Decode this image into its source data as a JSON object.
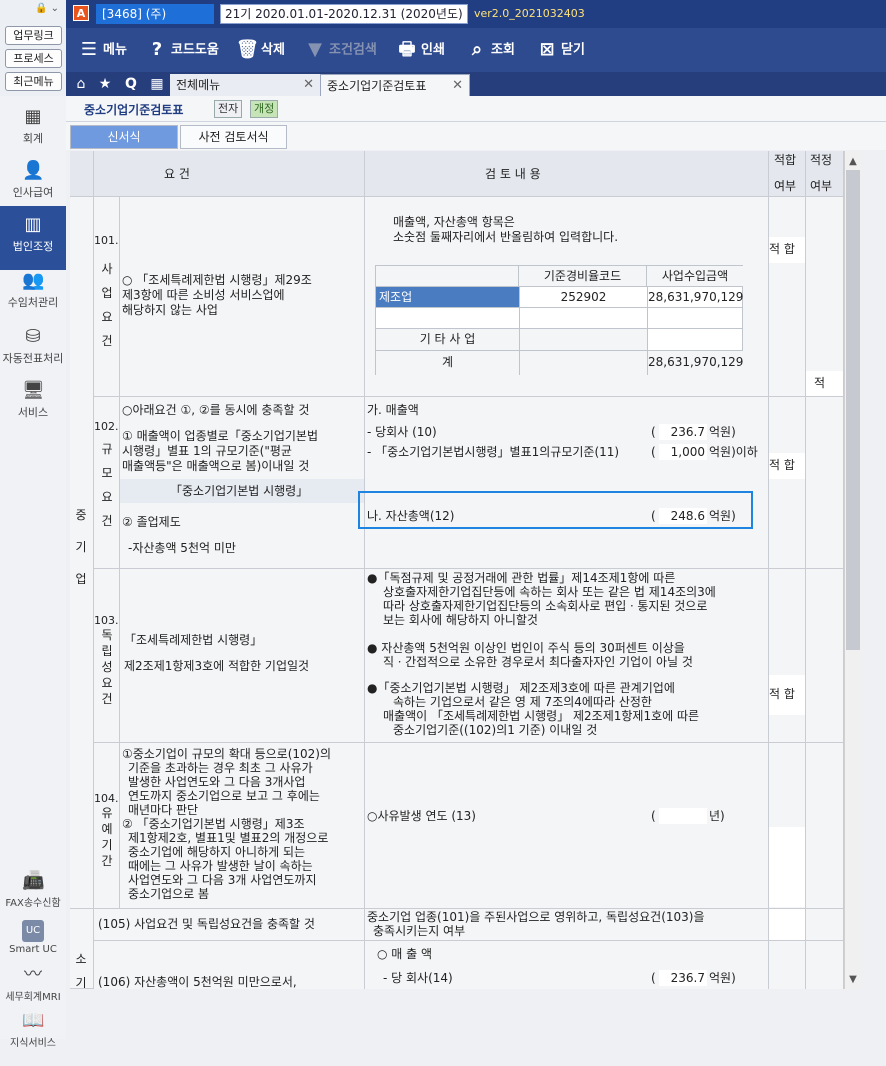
{
  "left_panel": {
    "top_buttons": [
      "업무링크",
      "프로세스",
      "최근메뉴"
    ],
    "nav": [
      {
        "label": "회계",
        "icon": "calculator-icon"
      },
      {
        "label": "인사급여",
        "icon": "person-icon"
      },
      {
        "label": "법인조정",
        "icon": "building-icon",
        "active": true
      },
      {
        "label": "수임처관리",
        "icon": "people-icon"
      },
      {
        "label": "자동전표처리",
        "icon": "database-icon"
      },
      {
        "label": "서비스",
        "icon": "monitor-icon"
      }
    ],
    "bottom_nav": [
      {
        "label": "FAX송수신함",
        "icon": "fax-icon"
      },
      {
        "label": "Smart UC",
        "icon": "uc-icon"
      },
      {
        "label": "세무회계MRI",
        "icon": "pulse-icon"
      },
      {
        "label": "지식서비스",
        "icon": "book-icon"
      }
    ]
  },
  "titlebar": {
    "app_letter": "A",
    "company": "[3468] (주)",
    "period": "21기 2020.01.01-2020.12.31 (2020년도)",
    "version": "ver2.0_2021032403"
  },
  "toolbar": {
    "menu": "메뉴",
    "code_help": "코드도움",
    "delete": "삭제",
    "filter": "조건검색",
    "print": "인쇄",
    "search": "조회",
    "close": "닫기"
  },
  "tabs": {
    "home_icon": "⌂",
    "star_icon": "★",
    "q_icon": "Q",
    "all_menu": "전체메뉴",
    "active_tab": "중소기업기준검토표",
    "close_glyph": "✕"
  },
  "page": {
    "title": "중소기업기준검토표",
    "badge_e": "전자",
    "badge_rev": "개정",
    "subtab_new": "신서식",
    "subtab_pre": "사전 검토서식"
  },
  "grid": {
    "header": {
      "requirement": "요           건",
      "review": "검     토     내     용",
      "fit1_a": "적합",
      "fit1_b": "여부",
      "fit2_a": "적정",
      "fit2_b": "여부"
    },
    "group_label": [
      "중",
      "기",
      "업"
    ],
    "row101": {
      "num": "101.",
      "vlabel": [
        "사",
        "업",
        "요",
        "건"
      ],
      "req_lines": [
        "○  「조세특례제한법 시행령」제29조",
        "    제3항에 따른 소비성 서비스업에",
        "    해당하지 않는 사업"
      ],
      "note1": "매출액, 자산총액 항목은",
      "note2": "소숫점 둘째자리에서 반올림하여 입력합니다.",
      "tbl_hdr_code": "기준경비율코드",
      "tbl_hdr_amt": "사업수입금액",
      "r1_name": "제조업",
      "r1_code": "252902",
      "r1_amt": "28,631,970,129",
      "r3_name": "기 타 사 업",
      "r4_name": "계",
      "r4_amt": "28,631,970,129",
      "fit": "적 합",
      "fit2": "적"
    },
    "row102": {
      "num": "102.",
      "vlabel": [
        "규",
        "모",
        "요",
        "건"
      ],
      "req_l1": "○아래요건 ①, ②를 동시에 충족할 것",
      "req_l2": "① 매출액이 업종별로「중소기업기본법",
      "req_l3": "시행령」별표 1의 규모기준(\"평균",
      "req_l4": "매출액등\"은 매출액으로 봄)이내일 것",
      "req_l5": "「중소기업기본법 시행령」",
      "req_l6": "②  졸업제도",
      "req_l7": "-자산총액 5천억 미만",
      "ga": "가. 매출액",
      "sales_line": "- 당회사 (10)",
      "sales_val": "236.7",
      "unit1": "억원)",
      "std_line": "- 「중소기업기본법시행령」별표1의규모기준(11)",
      "std_val": "1,000",
      "unit2": "억원)이하",
      "na": "나. 자산총액(12)",
      "asset_val": "248.6",
      "unit3": "억원)",
      "paren": "(",
      "fit": "적 합"
    },
    "row103": {
      "num": "103.",
      "vlabel": [
        "독",
        "립",
        "성",
        "요",
        "건"
      ],
      "req_l1": "「조세특례제한법 시행령」",
      "req_l2": "제2조제1항제3호에 적합한 기업일것",
      "b1_l1": "●「독점규제 및 공정거래에 관한 법률」제14조제1항에 따른",
      "b1_l2": "상호출자제한기업집단등에 속하는 회사 또는 같은 법 제14조의3에",
      "b1_l3": "따라 상호출자제한기업집단등의 소속회사로 편입ㆍ통지된 것으로",
      "b1_l4": "보는 회사에 해당하지 아니할것",
      "b2_l1": "● 자산총액 5천억원 이상인 법인이 주식 등의 30퍼센트 이상을",
      "b2_l2": "직ㆍ간접적으로 소유한 경우로서 최다출자자인 기업이 아닐 것",
      "b3_l1": "●「중소기업기본법 시행령」 제2조제3호에 따른 관계기업에",
      "b3_l2": "속하는 기업으로서 같은 영 제 7조의4에따라 산정한",
      "b3_l3": "매출액이 「조세특례제한법 시행령」 제2조제1항제1호에 따른",
      "b3_l4": "중소기업기준((102)의1 기준) 이내일 것",
      "fit": "적 합"
    },
    "row104": {
      "num": "104.",
      "vlabel": [
        "유",
        "예",
        "기",
        "간"
      ],
      "req": [
        "①중소기업이 규모의 확대 등으로(102)의",
        "기준을 초과하는 경우 최초 그 사유가",
        "발생한 사업연도와 그 다음 3개사업",
        "연도까지 중소기업으로 보고 그 후에는",
        "매년마다 판단",
        "② 「중소기업기본법 시행령」제3조",
        "제1항제2호, 별표1및 별표2의 개정으로",
        "중소기업에 해당하지 아니하게 되는",
        "때에는 그 사유가 발생한 날이 속하는",
        "사업연도와 그 다음 3개 사업연도까지",
        "중소기업으로 봄"
      ],
      "occur": "○사유발생 연도 (13)",
      "year_unit": "년)",
      "paren": "("
    },
    "row105": {
      "req": "(105) 사업요건 및 독립성요건을 충족할 것",
      "rev_l1": "중소기업 업종(101)을 주된사업으로 영위하고, 독립성요건(103)을",
      "rev_l2": "충족시키는지 여부"
    },
    "row106": {
      "group": [
        "소",
        "기"
      ],
      "req": "(106) 자산총액이 5천억원 미만으로서,",
      "sales_hdr": "○ 매 출 액",
      "co_line": "- 당 회사(14)",
      "co_val": "236.7",
      "unit": "억원)",
      "paren": "("
    }
  }
}
